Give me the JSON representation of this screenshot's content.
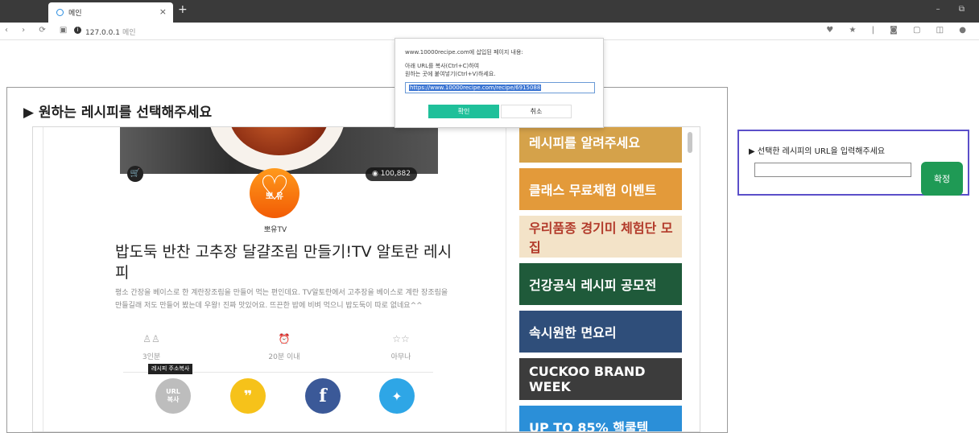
{
  "browser": {
    "tab_title": "메인",
    "tab_close": "×",
    "new_tab": "+",
    "window_controls": "– ⧉",
    "nav_icons": "‹ › ⟳ ▣",
    "address_host": "127.0.0.1",
    "address_path": "메인",
    "right_icons": "♥ ★ | ◙ ▢ ◫ ●"
  },
  "main": {
    "heading": "▶ 원하는 레시피를 선택해주세요"
  },
  "recipe": {
    "views": "◉ 100,882",
    "avatar_text": "뽀 유",
    "author": "뽀유TV",
    "title": "밥도둑 반찬 고추장 달걀조림 만들기!TV 알토란 레시피",
    "description": "평소 간장을 베이스로 한 계란장조림을 만들어 먹는 편인데요. TV알토란에서 고추장을 베이스로 계란 장조림을 만들길래 저도 만들어 봤는데 우왕! 진짜 맛있어요. 뜨끈한 밥에 비벼 먹으니 밥도둑이 따로 없네요^^",
    "servings": "3인분",
    "time": "20분 이내",
    "difficulty": "아무나",
    "servings_icon": "♙♙",
    "time_icon": "⏰",
    "difficulty_icon": "☆☆",
    "tooltip": "레시피 주소복사",
    "share_url_text": "URL\n복사",
    "share_kakao_icon": "❞",
    "share_fb_icon": "f",
    "share_tw_icon": "✦",
    "cart_icon": "🛒"
  },
  "ads": [
    {
      "text": "레시피를 알려주세요",
      "bg": "#d5a24a",
      "color": "#ffffff"
    },
    {
      "text": "클래스 무료체험 이벤트",
      "bg": "#e39a3a",
      "color": "#ffffff"
    },
    {
      "text": "우리품종 경기미 체험단 모집",
      "bg": "#f3e3c8",
      "color": "#b23a2a"
    },
    {
      "text": "건강공식 레시피 공모전",
      "bg": "#1f5a3a",
      "color": "#ffffff"
    },
    {
      "text": "속시원한 면요리",
      "bg": "#2f4e7a",
      "color": "#ffffff"
    },
    {
      "text": "CUCKOO BRAND WEEK",
      "bg": "#3c3c3c",
      "color": "#ffffff"
    },
    {
      "text": "UP TO 85% 핵쿨템",
      "bg": "#2b8fd8",
      "color": "#ffffff"
    }
  ],
  "right_panel": {
    "label": "▶ 선택한 레시피의 URL을 입력해주세요",
    "input_value": "",
    "confirm": "확정"
  },
  "dialog": {
    "title": "www.10000recipe.com에 삽입된 페이지 내용:",
    "message_line1": "아래 URL를 복사(Ctrl+C)하여",
    "message_line2": "원하는 곳에 붙여넣기(Ctrl+V)하세요.",
    "url": "https://www.10000recipe.com/recipe/6915088",
    "ok": "확인",
    "cancel": "취소"
  }
}
